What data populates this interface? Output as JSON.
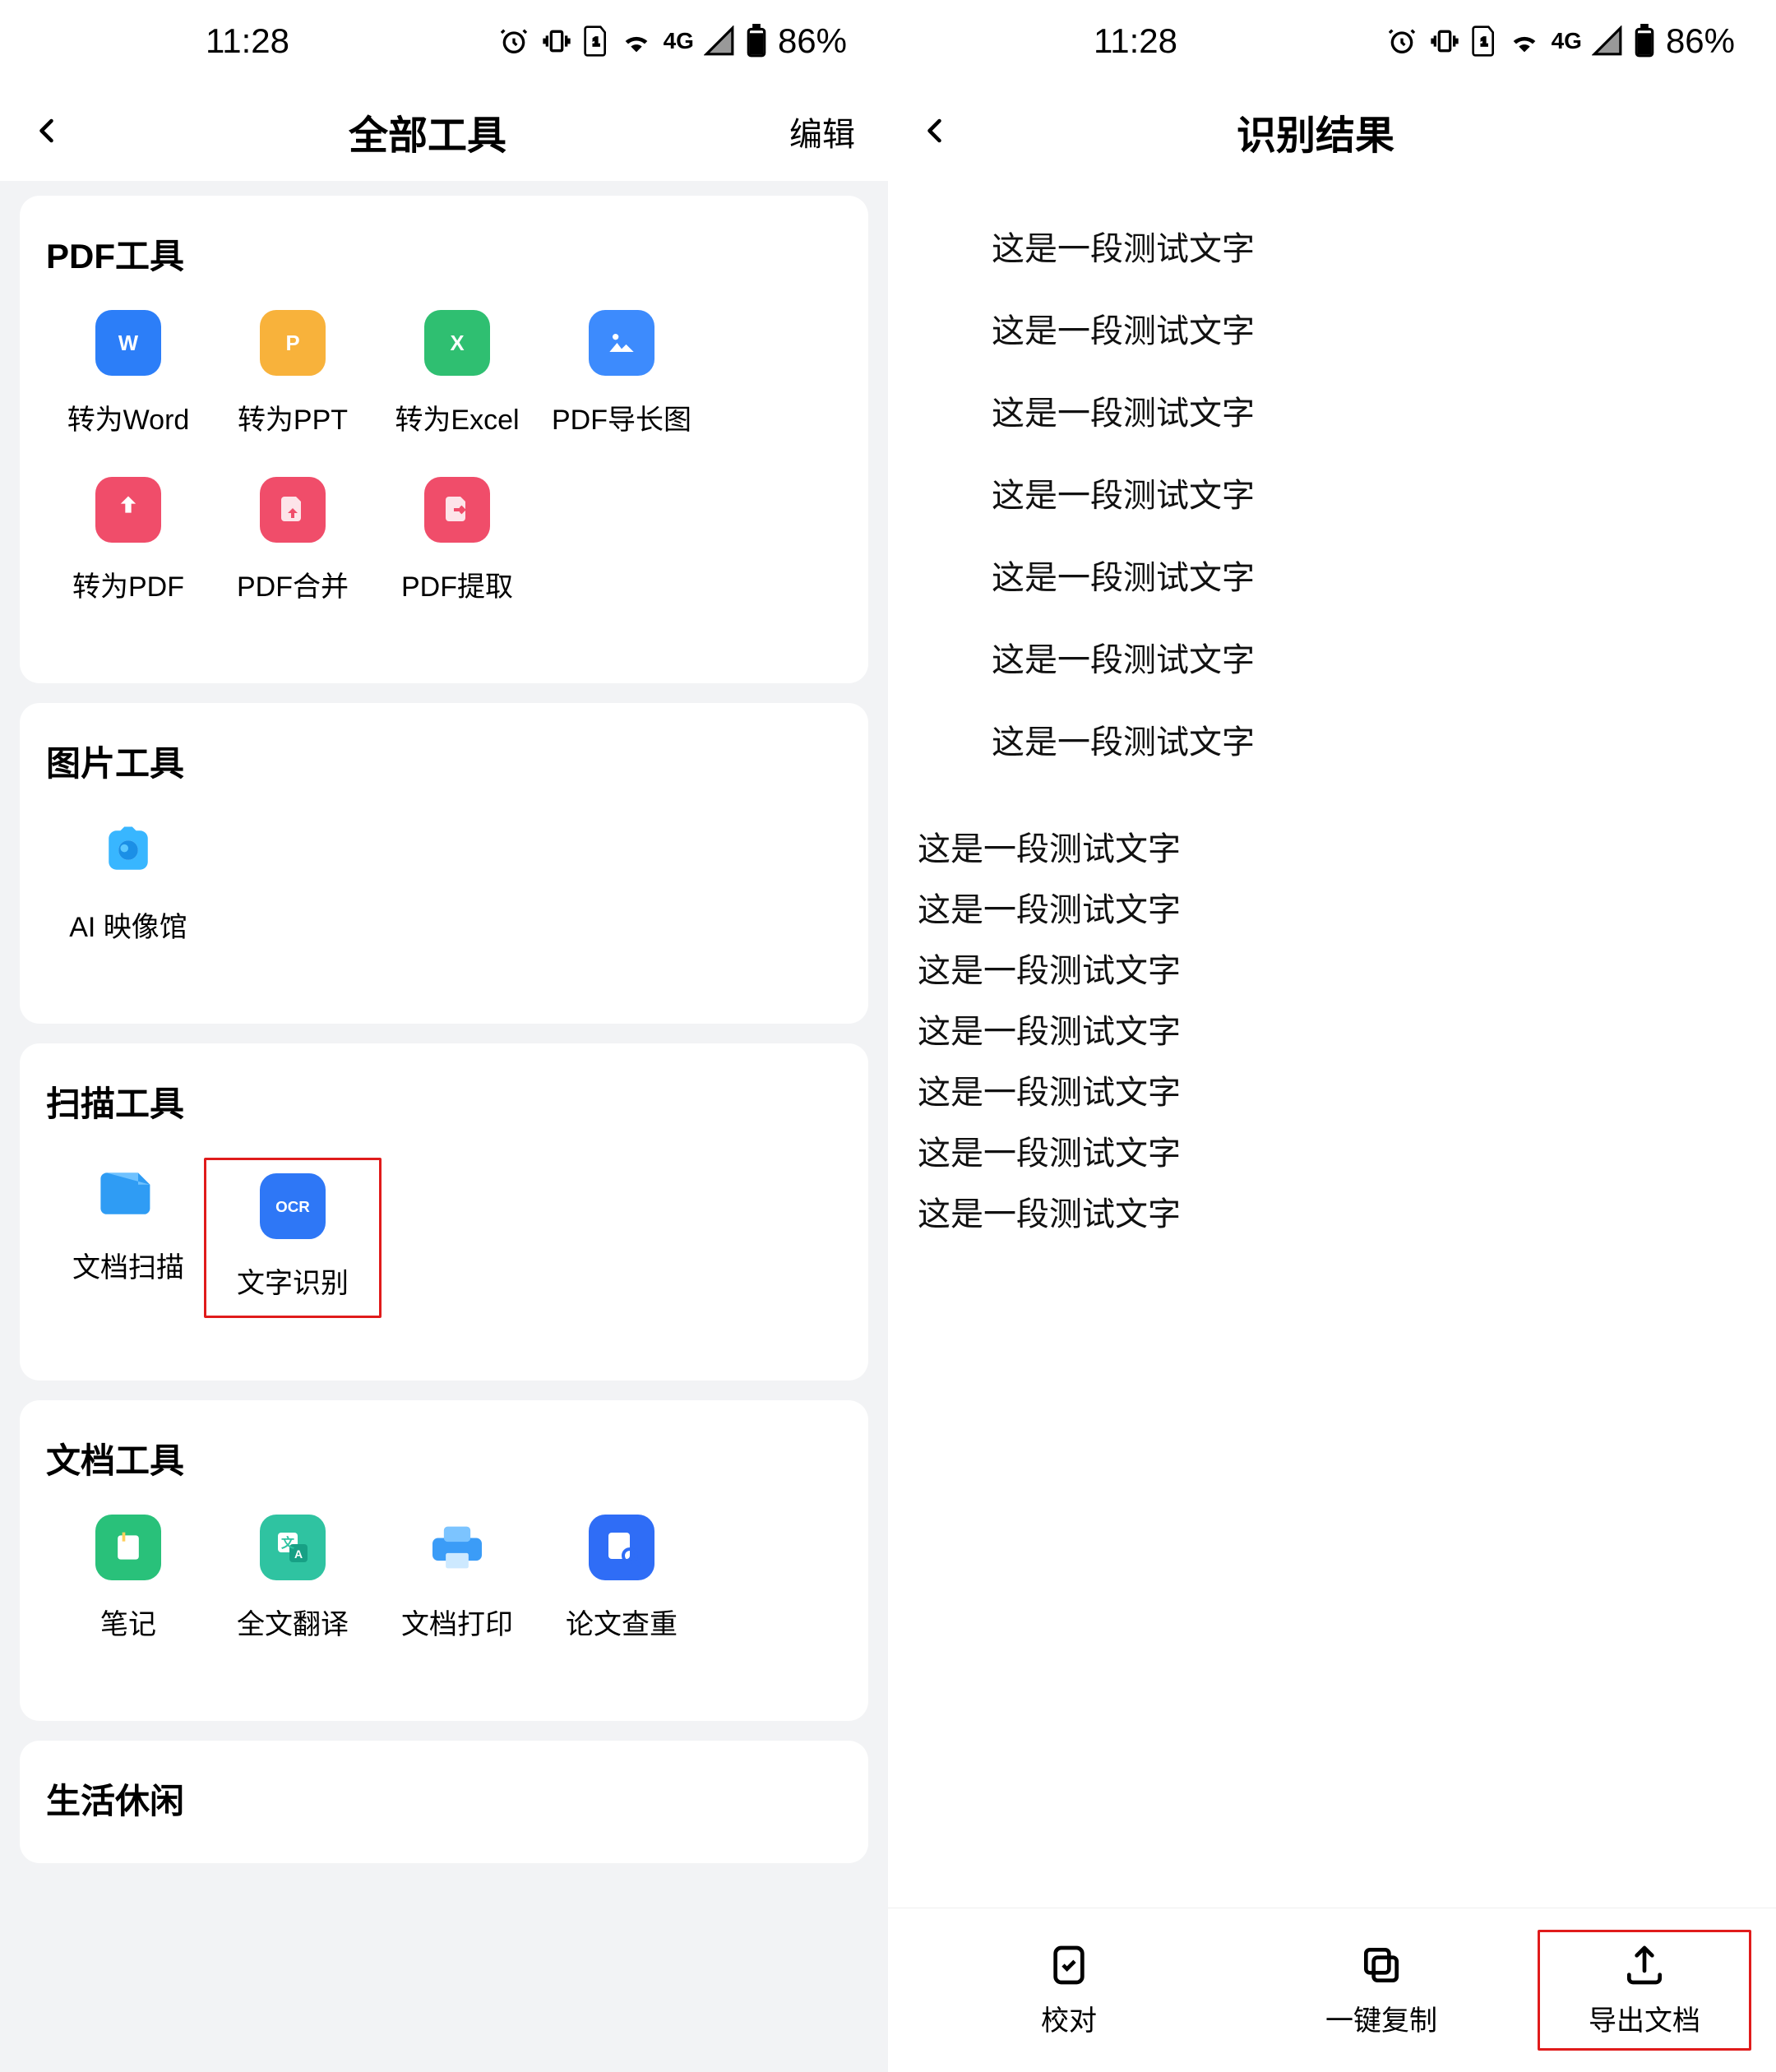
{
  "status": {
    "time": "11:28",
    "network": "4G",
    "battery": "86%"
  },
  "left": {
    "title": "全部工具",
    "edit": "编辑",
    "sections": {
      "pdf": {
        "title": "PDF工具",
        "items": [
          "转为Word",
          "转为PPT",
          "转为Excel",
          "PDF导长图",
          "转为PDF",
          "PDF合并",
          "PDF提取"
        ]
      },
      "image": {
        "title": "图片工具",
        "items": [
          "AI 映像馆"
        ]
      },
      "scan": {
        "title": "扫描工具",
        "items": [
          "文档扫描",
          "文字识别"
        ]
      },
      "doc": {
        "title": "文档工具",
        "items": [
          "笔记",
          "全文翻译",
          "文档打印",
          "论文查重"
        ]
      },
      "life": {
        "title": "生活休闲"
      }
    }
  },
  "right": {
    "title": "识别结果",
    "centered_lines": [
      "这是一段测试文字",
      "这是一段测试文字",
      "这是一段测试文字",
      "这是一段测试文字",
      "这是一段测试文字",
      "这是一段测试文字",
      "这是一段测试文字"
    ],
    "left_lines": [
      "这是一段测试文字",
      "这是一段测试文字",
      "这是一段测试文字",
      "这是一段测试文字",
      "这是一段测试文字",
      "这是一段测试文字",
      "这是一段测试文字"
    ],
    "tabs": {
      "proof": "校对",
      "copy": "一键复制",
      "export": "导出文档"
    }
  },
  "colors": {
    "word_blue": "#2c7ef8",
    "ppt_orange": "#f6a623",
    "excel_green": "#2fbf71",
    "pic_blue": "#3d8bfd",
    "pdf_red": "#f04d6a",
    "ocr_blue": "#2e77f6",
    "scan_blue": "#2f9cf4",
    "note_green": "#29c17a",
    "trans_teal": "#2fc3a1",
    "print_blue": "#3b9cf7",
    "check_blue": "#2f6df6",
    "ai_blue": "#38b6ff"
  }
}
